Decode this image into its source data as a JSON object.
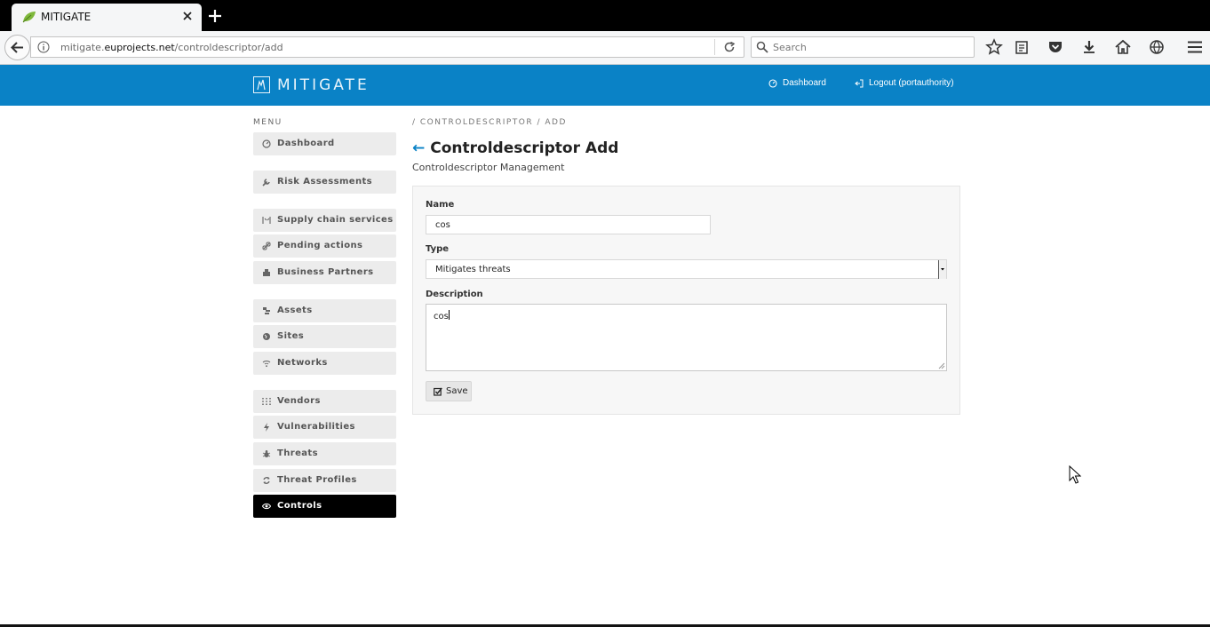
{
  "browser": {
    "tab_title": "MITIGATE",
    "url_host_prefix": "mitigate.",
    "url_host_domain": "euprojects.net",
    "url_path": "/controldescriptor/add",
    "search_placeholder": "Search"
  },
  "header": {
    "logo_text": "MITIGATE",
    "dashboard_link": "Dashboard",
    "logout_link": "Logout (portauthority)",
    "accent_color": "#0a82c6"
  },
  "sidebar": {
    "title": "MENU",
    "items": [
      {
        "label": "Dashboard",
        "icon": "dashboard-icon"
      },
      {
        "label": "Risk Assessments",
        "icon": "wrench-icon"
      },
      {
        "label": "Supply chain services",
        "icon": "chain-icon"
      },
      {
        "label": "Pending actions",
        "icon": "link-icon"
      },
      {
        "label": "Business Partners",
        "icon": "building-icon"
      },
      {
        "label": "Assets",
        "icon": "assets-icon"
      },
      {
        "label": "Sites",
        "icon": "globe-icon"
      },
      {
        "label": "Networks",
        "icon": "wifi-icon"
      },
      {
        "label": "Vendors",
        "icon": "grid-icon"
      },
      {
        "label": "Vulnerabilities",
        "icon": "bolt-icon"
      },
      {
        "label": "Threats",
        "icon": "bug-icon"
      },
      {
        "label": "Threat Profiles",
        "icon": "recycle-icon"
      },
      {
        "label": "Controls",
        "icon": "eye-icon",
        "active": true
      }
    ]
  },
  "main": {
    "breadcrumb": "/ CONTROLDESCRIPTOR / ADD",
    "title": "Controldescriptor Add",
    "back_arrow": "←",
    "subtitle": "Controldescriptor Management",
    "form": {
      "name_label": "Name",
      "name_value": "cos",
      "type_label": "Type",
      "type_value": "Mitigates threats",
      "description_label": "Description",
      "description_value": "cos",
      "save_label": "Save"
    }
  }
}
